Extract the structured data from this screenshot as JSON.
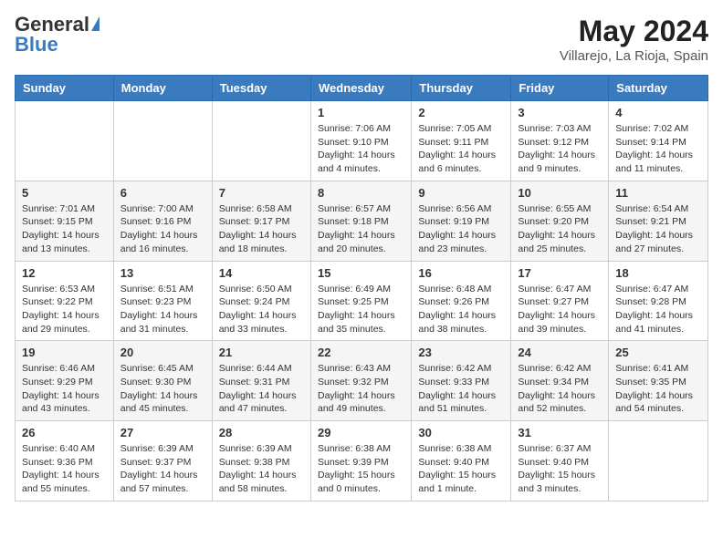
{
  "header": {
    "logo_general": "General",
    "logo_blue": "Blue",
    "month_year": "May 2024",
    "location": "Villarejo, La Rioja, Spain"
  },
  "days_of_week": [
    "Sunday",
    "Monday",
    "Tuesday",
    "Wednesday",
    "Thursday",
    "Friday",
    "Saturday"
  ],
  "weeks": [
    [
      {
        "day": "",
        "info": ""
      },
      {
        "day": "",
        "info": ""
      },
      {
        "day": "",
        "info": ""
      },
      {
        "day": "1",
        "info": "Sunrise: 7:06 AM\nSunset: 9:10 PM\nDaylight: 14 hours\nand 4 minutes."
      },
      {
        "day": "2",
        "info": "Sunrise: 7:05 AM\nSunset: 9:11 PM\nDaylight: 14 hours\nand 6 minutes."
      },
      {
        "day": "3",
        "info": "Sunrise: 7:03 AM\nSunset: 9:12 PM\nDaylight: 14 hours\nand 9 minutes."
      },
      {
        "day": "4",
        "info": "Sunrise: 7:02 AM\nSunset: 9:14 PM\nDaylight: 14 hours\nand 11 minutes."
      }
    ],
    [
      {
        "day": "5",
        "info": "Sunrise: 7:01 AM\nSunset: 9:15 PM\nDaylight: 14 hours\nand 13 minutes."
      },
      {
        "day": "6",
        "info": "Sunrise: 7:00 AM\nSunset: 9:16 PM\nDaylight: 14 hours\nand 16 minutes."
      },
      {
        "day": "7",
        "info": "Sunrise: 6:58 AM\nSunset: 9:17 PM\nDaylight: 14 hours\nand 18 minutes."
      },
      {
        "day": "8",
        "info": "Sunrise: 6:57 AM\nSunset: 9:18 PM\nDaylight: 14 hours\nand 20 minutes."
      },
      {
        "day": "9",
        "info": "Sunrise: 6:56 AM\nSunset: 9:19 PM\nDaylight: 14 hours\nand 23 minutes."
      },
      {
        "day": "10",
        "info": "Sunrise: 6:55 AM\nSunset: 9:20 PM\nDaylight: 14 hours\nand 25 minutes."
      },
      {
        "day": "11",
        "info": "Sunrise: 6:54 AM\nSunset: 9:21 PM\nDaylight: 14 hours\nand 27 minutes."
      }
    ],
    [
      {
        "day": "12",
        "info": "Sunrise: 6:53 AM\nSunset: 9:22 PM\nDaylight: 14 hours\nand 29 minutes."
      },
      {
        "day": "13",
        "info": "Sunrise: 6:51 AM\nSunset: 9:23 PM\nDaylight: 14 hours\nand 31 minutes."
      },
      {
        "day": "14",
        "info": "Sunrise: 6:50 AM\nSunset: 9:24 PM\nDaylight: 14 hours\nand 33 minutes."
      },
      {
        "day": "15",
        "info": "Sunrise: 6:49 AM\nSunset: 9:25 PM\nDaylight: 14 hours\nand 35 minutes."
      },
      {
        "day": "16",
        "info": "Sunrise: 6:48 AM\nSunset: 9:26 PM\nDaylight: 14 hours\nand 38 minutes."
      },
      {
        "day": "17",
        "info": "Sunrise: 6:47 AM\nSunset: 9:27 PM\nDaylight: 14 hours\nand 39 minutes."
      },
      {
        "day": "18",
        "info": "Sunrise: 6:47 AM\nSunset: 9:28 PM\nDaylight: 14 hours\nand 41 minutes."
      }
    ],
    [
      {
        "day": "19",
        "info": "Sunrise: 6:46 AM\nSunset: 9:29 PM\nDaylight: 14 hours\nand 43 minutes."
      },
      {
        "day": "20",
        "info": "Sunrise: 6:45 AM\nSunset: 9:30 PM\nDaylight: 14 hours\nand 45 minutes."
      },
      {
        "day": "21",
        "info": "Sunrise: 6:44 AM\nSunset: 9:31 PM\nDaylight: 14 hours\nand 47 minutes."
      },
      {
        "day": "22",
        "info": "Sunrise: 6:43 AM\nSunset: 9:32 PM\nDaylight: 14 hours\nand 49 minutes."
      },
      {
        "day": "23",
        "info": "Sunrise: 6:42 AM\nSunset: 9:33 PM\nDaylight: 14 hours\nand 51 minutes."
      },
      {
        "day": "24",
        "info": "Sunrise: 6:42 AM\nSunset: 9:34 PM\nDaylight: 14 hours\nand 52 minutes."
      },
      {
        "day": "25",
        "info": "Sunrise: 6:41 AM\nSunset: 9:35 PM\nDaylight: 14 hours\nand 54 minutes."
      }
    ],
    [
      {
        "day": "26",
        "info": "Sunrise: 6:40 AM\nSunset: 9:36 PM\nDaylight: 14 hours\nand 55 minutes."
      },
      {
        "day": "27",
        "info": "Sunrise: 6:39 AM\nSunset: 9:37 PM\nDaylight: 14 hours\nand 57 minutes."
      },
      {
        "day": "28",
        "info": "Sunrise: 6:39 AM\nSunset: 9:38 PM\nDaylight: 14 hours\nand 58 minutes."
      },
      {
        "day": "29",
        "info": "Sunrise: 6:38 AM\nSunset: 9:39 PM\nDaylight: 15 hours\nand 0 minutes."
      },
      {
        "day": "30",
        "info": "Sunrise: 6:38 AM\nSunset: 9:40 PM\nDaylight: 15 hours\nand 1 minute."
      },
      {
        "day": "31",
        "info": "Sunrise: 6:37 AM\nSunset: 9:40 PM\nDaylight: 15 hours\nand 3 minutes."
      },
      {
        "day": "",
        "info": ""
      }
    ]
  ]
}
